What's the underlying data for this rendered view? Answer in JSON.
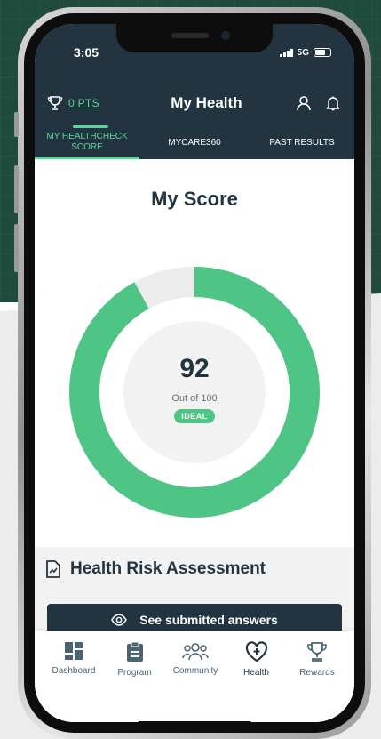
{
  "status_bar": {
    "time": "3:05",
    "network": "5G"
  },
  "header": {
    "points": "0 PTS",
    "title": "My Health",
    "tabs": [
      {
        "label": "MY HEALTHCHECK SCORE",
        "active": true
      },
      {
        "label": "MYCARE360",
        "active": false
      },
      {
        "label": "PAST RESULTS",
        "active": false
      }
    ]
  },
  "score": {
    "heading": "My Score",
    "value": "92",
    "out_of": "Out of 100",
    "status": "IDEAL",
    "fraction": 0.92
  },
  "hra": {
    "title": "Health Risk Assessment",
    "button_label": "See submitted answers"
  },
  "nav": {
    "items": [
      {
        "label": "Dashboard",
        "icon": "dashboard-icon"
      },
      {
        "label": "Program",
        "icon": "clipboard-icon"
      },
      {
        "label": "Community",
        "icon": "community-icon"
      },
      {
        "label": "Health",
        "icon": "heart-plus-icon",
        "active": true
      },
      {
        "label": "Rewards",
        "icon": "trophy-icon"
      }
    ]
  },
  "colors": {
    "header": "#233441",
    "accent": "#4fc585",
    "gauge_track": "#ececec",
    "text_dark": "#233441"
  }
}
